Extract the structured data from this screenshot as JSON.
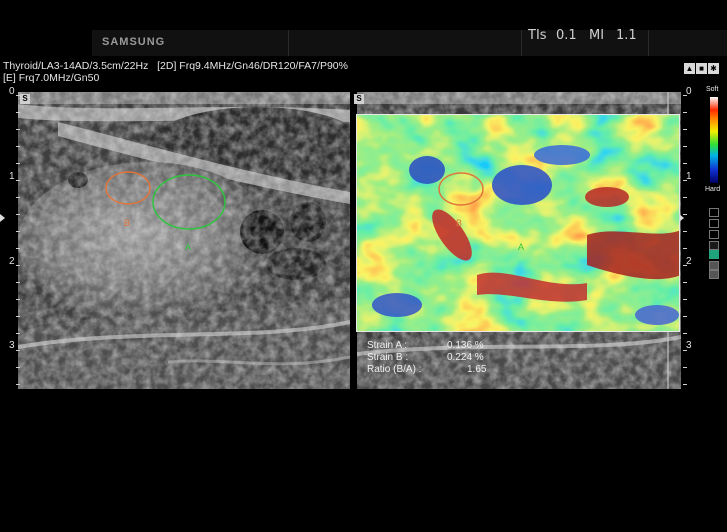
{
  "header": {
    "brand": "SAMSUNG",
    "tis_label": "TIs",
    "tis_value": "0.1",
    "mi_label": "MI",
    "mi_value": "1.1"
  },
  "info": {
    "preset": "Thyroid",
    "probe": "LA3-14AD",
    "depth": "3.5cm",
    "rate": "22Hz",
    "mode_2d": "[2D]",
    "settings_2d": "Frq9.4MHz/Gn46/DR120/FA7/P90%",
    "mode_e": "[E]",
    "settings_e": "Frq7.0MHz/Gn50"
  },
  "scale": {
    "left": [
      "0",
      "1",
      "2",
      "3"
    ],
    "right": [
      "0",
      "1",
      "2",
      "3"
    ]
  },
  "view_markers": {
    "left": "S",
    "right": "S"
  },
  "roi_labels": {
    "b_left": "B",
    "a_left": "A",
    "b_right": "B",
    "a_right": "A"
  },
  "colorbar": {
    "top": "Soft",
    "bottom": "Hard"
  },
  "measurements": [
    {
      "label": "Strain A :",
      "value": "0.136 %"
    },
    {
      "label": "Strain B :",
      "value": "0.224 %"
    },
    {
      "label": "Ratio (B/A) :",
      "value": "1.65"
    }
  ],
  "colors": {
    "roi_b": "#e0743a",
    "roi_a": "#2ec43e",
    "selected_square": "#1fa37a"
  }
}
